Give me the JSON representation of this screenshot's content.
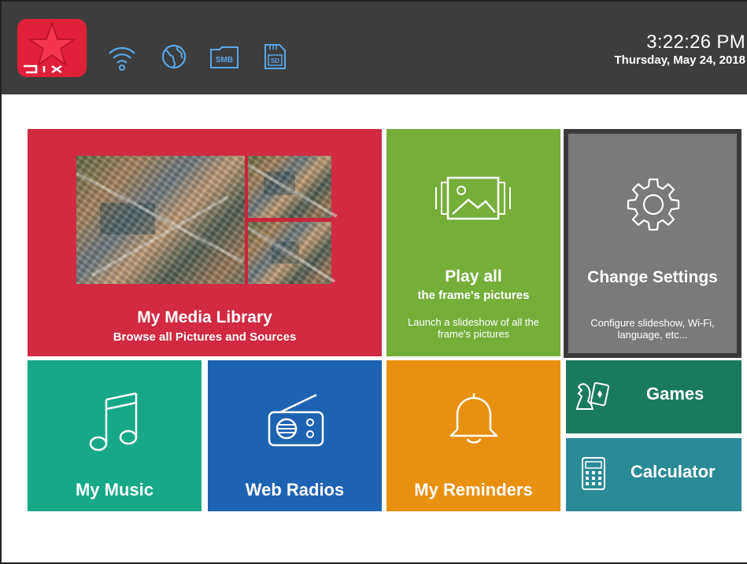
{
  "status": {
    "wifi_icon": "wifi-icon",
    "web_icon": "globe-icon",
    "smb_label": "SMB",
    "sd_label": "SD"
  },
  "logo": {
    "text": "PIX",
    "icon": "star-icon"
  },
  "clock": {
    "time": "3:22:26 PM",
    "date": "Thursday, May 24, 2018"
  },
  "tiles": {
    "media": {
      "title": "My Media Library",
      "subtitle": "Browse all Pictures and Sources"
    },
    "play": {
      "title": "Play all",
      "subtitle": "the frame's pictures",
      "description": "Launch a slideshow of all the frame's pictures",
      "icon": "slideshow-icon"
    },
    "settings": {
      "title": "Change Settings",
      "description": "Configure slideshow, Wi-Fi, language, etc...",
      "icon": "gear-icon"
    },
    "music": {
      "title": "My Music",
      "icon": "music-note-icon"
    },
    "radio": {
      "title": "Web Radios",
      "icon": "radio-icon"
    },
    "reminders": {
      "title": "My Reminders",
      "icon": "bell-icon"
    },
    "games": {
      "title": "Games",
      "icon": "cards-icon"
    },
    "calculator": {
      "title": "Calculator",
      "icon": "calculator-icon"
    }
  },
  "colors": {
    "topbar": "#3d3d3d",
    "media": "#d12a42",
    "play": "#76ae3a",
    "settings": "#7a7a7a",
    "music": "#17a887",
    "radio": "#1d63b2",
    "reminders": "#e89010",
    "games": "#1a7a5e",
    "calculator": "#2a8a98"
  }
}
